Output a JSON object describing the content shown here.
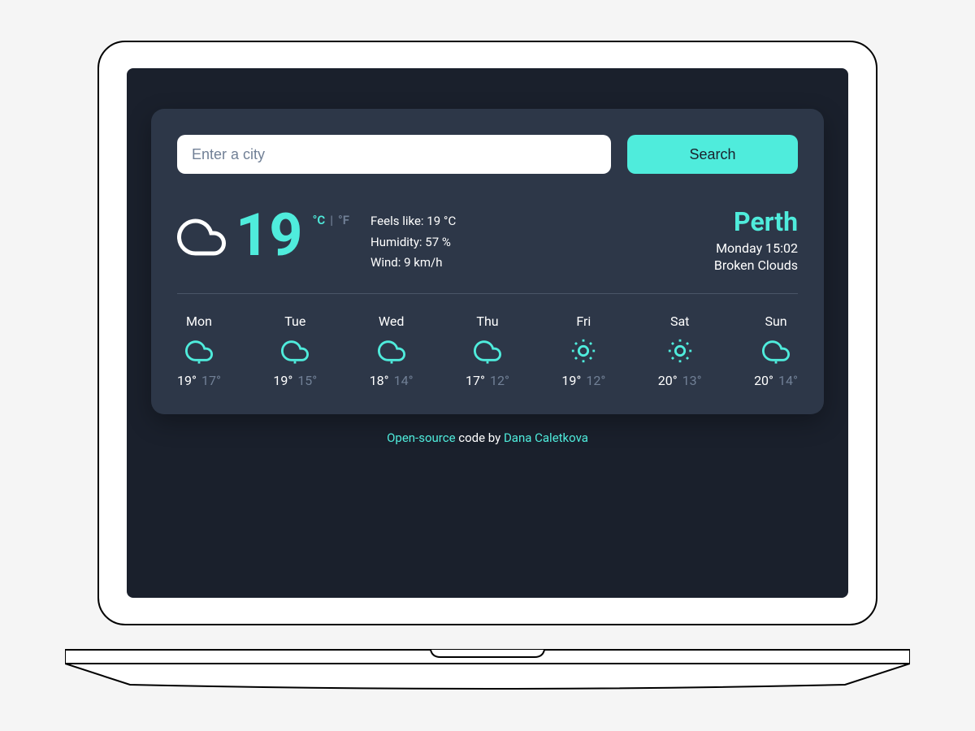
{
  "search": {
    "placeholder": "Enter a city",
    "button_label": "Search"
  },
  "current": {
    "temp": "19",
    "unit_c": "°C",
    "unit_f": "°F",
    "unit_divider": "|",
    "feels_like": "Feels like: 19 °C",
    "humidity": "Humidity: 57 %",
    "wind": "Wind: 9 km/h",
    "city": "Perth",
    "datetime": "Monday 15:02",
    "condition": "Broken Clouds",
    "icon": "cloud-icon"
  },
  "forecast": [
    {
      "day": "Mon",
      "icon": "rain",
      "high": "19°",
      "low": "17°"
    },
    {
      "day": "Tue",
      "icon": "rain",
      "high": "19°",
      "low": "15°"
    },
    {
      "day": "Wed",
      "icon": "rain",
      "high": "18°",
      "low": "14°"
    },
    {
      "day": "Thu",
      "icon": "rain",
      "high": "17°",
      "low": "12°"
    },
    {
      "day": "Fri",
      "icon": "sun",
      "high": "19°",
      "low": "12°"
    },
    {
      "day": "Sat",
      "icon": "sun",
      "high": "20°",
      "low": "13°"
    },
    {
      "day": "Sun",
      "icon": "rain",
      "high": "20°",
      "low": "14°"
    }
  ],
  "footer": {
    "link1": "Open-source",
    "mid": " code by ",
    "link2": "Dana Caletkova"
  },
  "colors": {
    "accent": "#4fecdc",
    "bg_dark": "#1a202c",
    "bg_card": "#2d3748",
    "text_muted": "#718096"
  }
}
